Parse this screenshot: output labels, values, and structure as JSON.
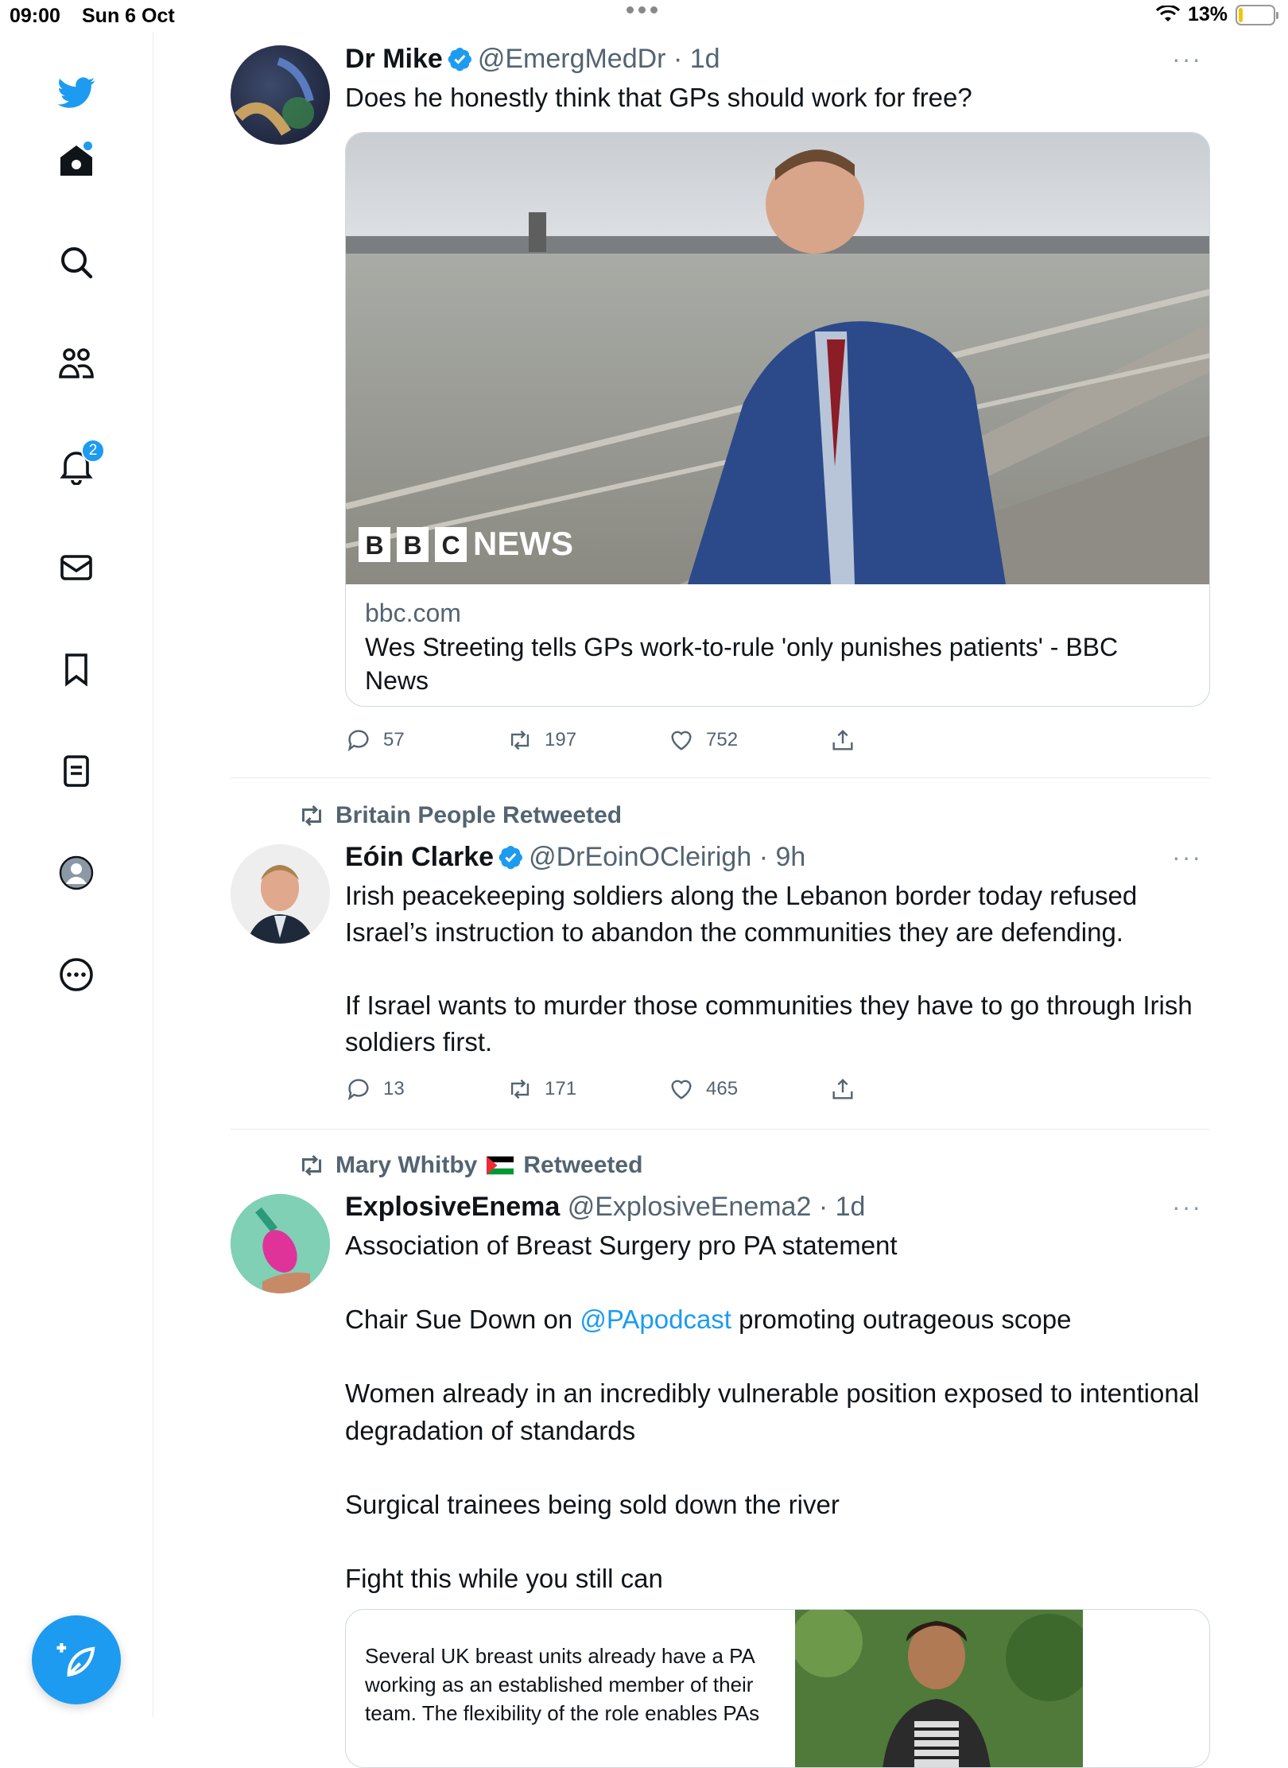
{
  "status_bar": {
    "time": "09:00",
    "date": "Sun 6 Oct",
    "battery": "13%",
    "battery_level": 0.13
  },
  "sidebar": {
    "items": [
      {
        "icon": "twitter-bird-icon",
        "label": "Twitter"
      },
      {
        "icon": "home-icon",
        "label": "Home"
      },
      {
        "icon": "search-icon",
        "label": "Explore"
      },
      {
        "icon": "communities-icon",
        "label": "Communities"
      },
      {
        "icon": "bell-icon",
        "label": "Notifications",
        "badge": "2"
      },
      {
        "icon": "mail-icon",
        "label": "Messages"
      },
      {
        "icon": "bookmark-icon",
        "label": "Bookmarks"
      },
      {
        "icon": "lists-icon",
        "label": "Lists"
      },
      {
        "icon": "profile-icon",
        "label": "Profile"
      },
      {
        "icon": "more-circle-icon",
        "label": "More"
      }
    ],
    "compose_icon": "compose-feather-icon"
  },
  "colors": {
    "accent": "#1d9bf0",
    "text": "#0f1419",
    "secondary": "#536471",
    "border": "#cfd9de"
  },
  "tweets": [
    {
      "name": "Dr Mike",
      "verified": true,
      "handle": "@EmergMedDr",
      "time": "· 1d",
      "text": "Does he honestly think that GPs should work for free?",
      "card": {
        "image_label": "BBC NEWS",
        "domain": "bbc.com",
        "title": "Wes Streeting tells GPs work-to-rule 'only punishes patients' - BBC News"
      },
      "replies": "57",
      "retweets": "197",
      "likes": "752"
    },
    {
      "retweeted_by": "Britain People Retweeted",
      "name": "Eóin Clarke",
      "verified": true,
      "handle": "@DrEoinOCleirigh",
      "time": "· 9h",
      "text": "Irish peacekeeping soldiers along the Lebanon border today refused Israel’s instruction to abandon the communities they are defending.\n\nIf Israel wants to murder those communities they have to go through Irish soldiers first.",
      "replies": "13",
      "retweets": "171",
      "likes": "465"
    },
    {
      "retweeted_by_name": "Mary Whitby",
      "retweeted_by_suffix": "Retweeted",
      "name": "ExplosiveEnema",
      "verified": false,
      "handle": "@ExplosiveEnema2",
      "time": "· 1d",
      "text_1": "Association of Breast Surgery pro PA statement\n\nChair Sue Down on ",
      "mention": "@PApodcast",
      "text_2": " promoting outrageous scope\n\nWomen already in an incredibly vulnerable position exposed to intentional degradation of standards\n\nSurgical trainees being sold down the river\n\nFight this while you still can",
      "card": {
        "snippet": "Several UK breast units already have a PA working as an established member of their team. The flexibility of the role enables PAs"
      }
    }
  ]
}
